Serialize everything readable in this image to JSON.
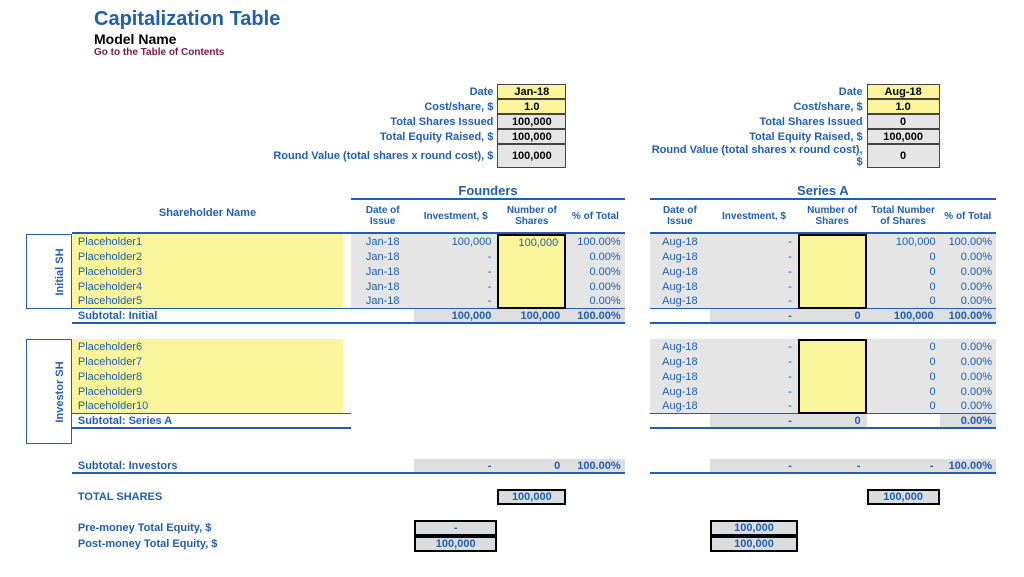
{
  "title": "Capitalization Table",
  "subtitle": "Model Name",
  "toc_link": "Go to the Table of Contents",
  "labels": {
    "date": "Date",
    "cost": "Cost/share, $",
    "tsi": "Total Shares Issued",
    "ter": "Total Equity Raised, $",
    "rv": "Round Value (total shares x round cost), $",
    "shareholder": "Shareholder Name",
    "founders": "Founders",
    "seriesA": "Series A",
    "dateOfIssue": "Date of Issue",
    "investment": "Investment, $",
    "numShares": "Number of Shares",
    "totNumShares": "Total Number of Shares",
    "pctTotal": "% of Total",
    "initialSH": "Initial SH",
    "investorSH": "Investor SH",
    "subInitial": "Subtotal: Initial",
    "subSeriesA": "Subtotal: Series A",
    "subInvestors": "Subtotal: Investors",
    "totalShares": "TOTAL SHARES",
    "preMoney": "Pre-money Total Equity, $",
    "postMoney": "Post-money Total Equity, $"
  },
  "founders": {
    "date": "Jan-18",
    "cost": "1.0",
    "tsi": "100,000",
    "ter": "100,000",
    "rv": "100,000"
  },
  "seriesA": {
    "date": "Aug-18",
    "cost": "1.0",
    "tsi": "0",
    "ter": "100,000",
    "rv": "0"
  },
  "initial": [
    {
      "name": "Placeholder1",
      "fDate": "Jan-18",
      "fInv": "100,000",
      "fShares": "100,000",
      "fPct": "100.00%",
      "sDate": "Aug-18",
      "sInv": "-",
      "sShares": "",
      "sTot": "100,000",
      "sPct": "100.00%"
    },
    {
      "name": "Placeholder2",
      "fDate": "Jan-18",
      "fInv": "-",
      "fShares": "",
      "fPct": "0.00%",
      "sDate": "Aug-18",
      "sInv": "-",
      "sShares": "",
      "sTot": "0",
      "sPct": "0.00%"
    },
    {
      "name": "Placeholder3",
      "fDate": "Jan-18",
      "fInv": "-",
      "fShares": "",
      "fPct": "0.00%",
      "sDate": "Aug-18",
      "sInv": "-",
      "sShares": "",
      "sTot": "0",
      "sPct": "0.00%"
    },
    {
      "name": "Placeholder4",
      "fDate": "Jan-18",
      "fInv": "-",
      "fShares": "",
      "fPct": "0.00%",
      "sDate": "Aug-18",
      "sInv": "-",
      "sShares": "",
      "sTot": "0",
      "sPct": "0.00%"
    },
    {
      "name": "Placeholder5",
      "fDate": "Jan-18",
      "fInv": "-",
      "fShares": "",
      "fPct": "0.00%",
      "sDate": "Aug-18",
      "sInv": "-",
      "sShares": "",
      "sTot": "0",
      "sPct": "0.00%"
    }
  ],
  "subInitial": {
    "fInv": "100,000",
    "fShares": "100,000",
    "fPct": "100.00%",
    "sInv": "-",
    "sShares": "0",
    "sTot": "100,000",
    "sPct": "100.00%"
  },
  "investors": [
    {
      "name": "Placeholder6",
      "sDate": "Aug-18",
      "sInv": "-",
      "sShares": "",
      "sTot": "0",
      "sPct": "0.00%"
    },
    {
      "name": "Placeholder7",
      "sDate": "Aug-18",
      "sInv": "-",
      "sShares": "",
      "sTot": "0",
      "sPct": "0.00%"
    },
    {
      "name": "Placeholder8",
      "sDate": "Aug-18",
      "sInv": "-",
      "sShares": "",
      "sTot": "0",
      "sPct": "0.00%"
    },
    {
      "name": "Placeholder9",
      "sDate": "Aug-18",
      "sInv": "-",
      "sShares": "",
      "sTot": "0",
      "sPct": "0.00%"
    },
    {
      "name": "Placeholder10",
      "sDate": "Aug-18",
      "sInv": "-",
      "sShares": "",
      "sTot": "0",
      "sPct": "0.00%"
    }
  ],
  "subSeriesA": {
    "sInv": "-",
    "sShares": "0",
    "sTot": "",
    "sPct": "0.00%"
  },
  "subInvestors": {
    "fInv": "-",
    "fShares": "0",
    "fPct": "100.00%",
    "sInv": "-",
    "sShares": "-",
    "sTot": "-",
    "sPct": "100.00%"
  },
  "totals": {
    "fShares": "100,000",
    "sTot": "100,000"
  },
  "equity": {
    "fPre": "-",
    "fPost": "100,000",
    "sPre": "100,000",
    "sPost": "100,000"
  }
}
